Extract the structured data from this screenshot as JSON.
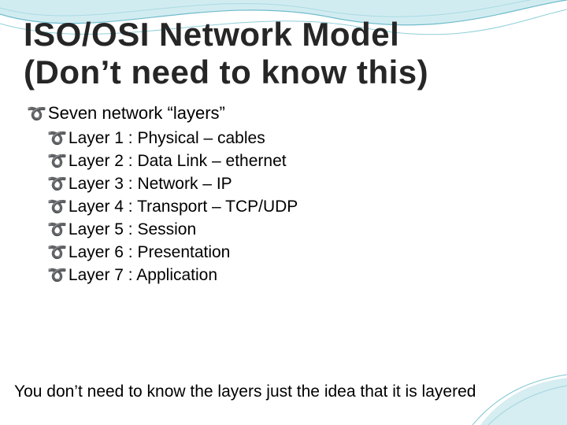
{
  "title_line1": "ISO/OSI Network Model",
  "title_line2": "(Don’t need to know this)",
  "main_bullet": "Seven network “layers”",
  "layers": [
    "Layer 1 : Physical – cables",
    "Layer 2 : Data Link – ethernet",
    "Layer 3 : Network – IP",
    "Layer 4 : Transport – TCP/UDP",
    "Layer 5 : Session",
    "Layer 6 : Presentation",
    "Layer 7 : Application"
  ],
  "footer": "You don’t need to know the layers just the idea that it is layered"
}
